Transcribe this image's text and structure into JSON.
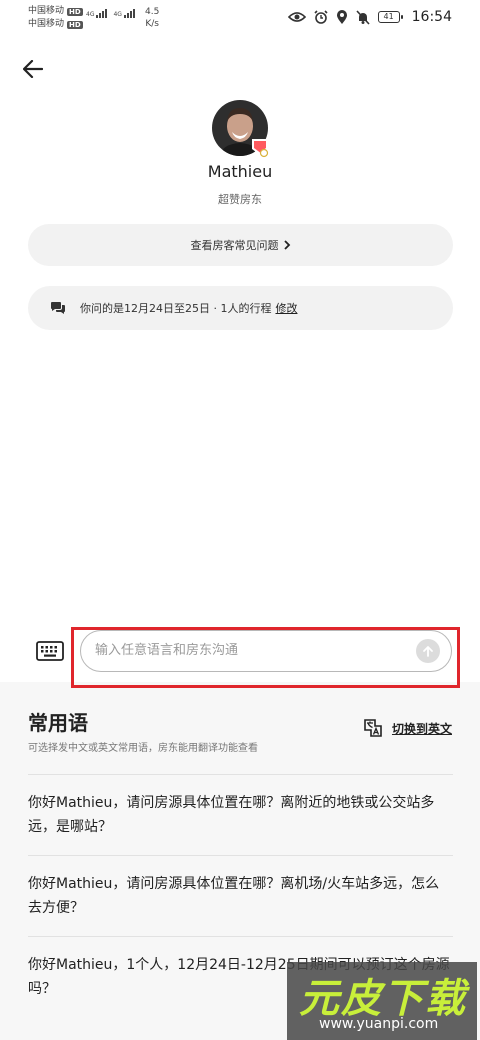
{
  "status_bar": {
    "carrier1": "中国移动",
    "carrier2": "中国移动",
    "hd_label": "HD",
    "network": "4G",
    "speed_value": "4.5",
    "speed_unit": "K/s",
    "battery": "41",
    "time": "16:54"
  },
  "host": {
    "name": "Mathieu",
    "subtitle": "超赞房东"
  },
  "faq_button": {
    "label": "查看房客常见问题"
  },
  "trip": {
    "text": "你问的是12月24日至25日 · 1人的行程",
    "modify_label": "修改"
  },
  "input": {
    "placeholder": "输入任意语言和房东沟通"
  },
  "phrases_panel": {
    "title": "常用语",
    "description": "可选择发中文或英文常用语，房东能用翻译功能查看",
    "switch_label": "切换到英文",
    "items": [
      "你好Mathieu，请问房源具体位置在哪？离附近的地铁或公交站多远，是哪站？",
      "你好Mathieu，请问房源具体位置在哪？离机场/火车站多远，怎么去方便？",
      "你好Mathieu，1个人，12月24日-12月25日期间可以预订这个房源吗？"
    ]
  },
  "watermark": {
    "title": "元皮下载",
    "url": "www.yuanpi.com"
  },
  "colors": {
    "highlight": "#e0262c",
    "panel_bg": "#f7f7f7",
    "pill_bg": "#f2f2f2",
    "watermark_text": "#c8ef3a"
  }
}
